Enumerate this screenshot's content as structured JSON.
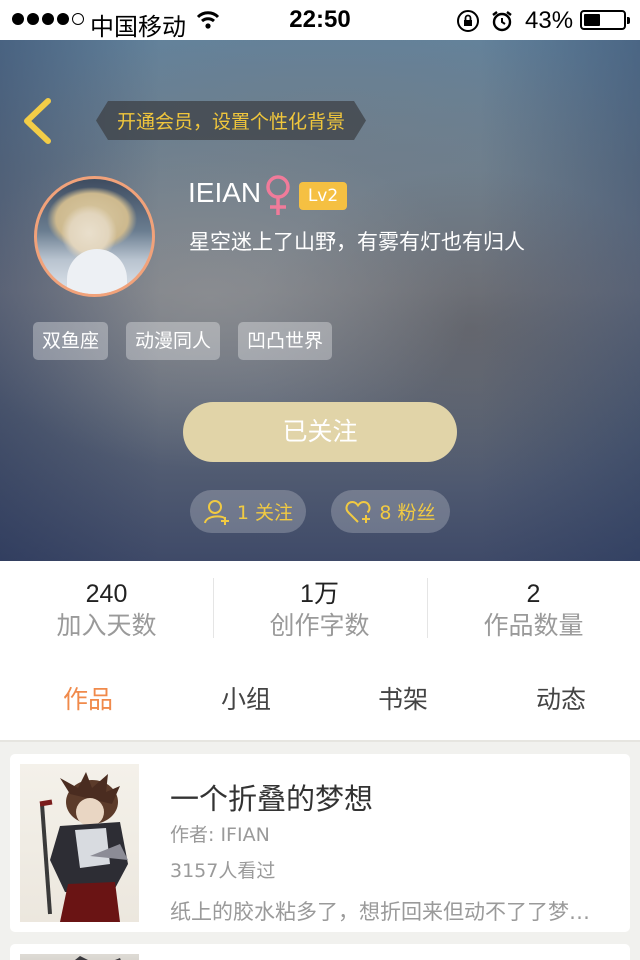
{
  "status_bar": {
    "carrier": "中国移动",
    "time": "22:50",
    "battery_percent": "43%",
    "battery_level": 0.43
  },
  "header": {
    "vip_tip": "开通会员，设置个性化背景",
    "back_icon": "chevron-left-icon"
  },
  "profile": {
    "username": "IEIAN",
    "gender_icon": "female-symbol-icon",
    "level": "Lv2",
    "signature": "星空迷上了山野，有雾有灯也有归人",
    "tags": [
      "双鱼座",
      "动漫同人",
      "凹凸世界"
    ],
    "follow_button": "已关注",
    "following_count": "1 关注",
    "fans_count": "8 粉丝"
  },
  "stats": [
    {
      "value": "240",
      "label": "加入天数"
    },
    {
      "value": "1万",
      "label": "创作字数"
    },
    {
      "value": "2",
      "label": "作品数量"
    }
  ],
  "tabs": [
    {
      "label": "作品",
      "active": true
    },
    {
      "label": "小组",
      "active": false
    },
    {
      "label": "书架",
      "active": false
    },
    {
      "label": "动态",
      "active": false
    }
  ],
  "works": [
    {
      "title": "一个折叠的梦想",
      "author": "作者: IFIAN",
      "views": "3157人看过",
      "description": "纸上的胶水粘多了，想折回来但动不了了梦…"
    }
  ],
  "colors": {
    "accent_orange": "#f08a4b",
    "gold": "#f1ca42",
    "follow_button_bg": "#e1d4a8",
    "level_badge": "#f5c042"
  }
}
